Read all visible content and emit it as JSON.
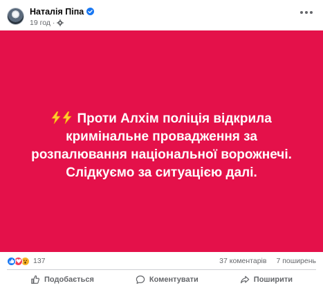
{
  "post": {
    "author_name": "Наталія Піпа",
    "time": "19 год",
    "meta_separator": "·",
    "more_icon": "more-horizontal-icon",
    "verified_icon": "verified-badge-icon",
    "audience_icon": "gear-icon"
  },
  "card": {
    "background_color": "#e4114a",
    "text_color": "#ffffff",
    "lines": [
      "Проти Алхім поліція відкрила",
      "кримінальне провадження за",
      "розпалювання національної ворожнечі.",
      "Слідкуємо за ситуацією далі."
    ],
    "emoji": "high-voltage-emoji"
  },
  "stats": {
    "reactions": [
      "like",
      "love",
      "wow"
    ],
    "reaction_count": "137",
    "comments": "37 коментарів",
    "shares": "7 поширень"
  },
  "actions": {
    "like_label": "Подобається",
    "comment_label": "Коментувати",
    "share_label": "Поширити"
  }
}
